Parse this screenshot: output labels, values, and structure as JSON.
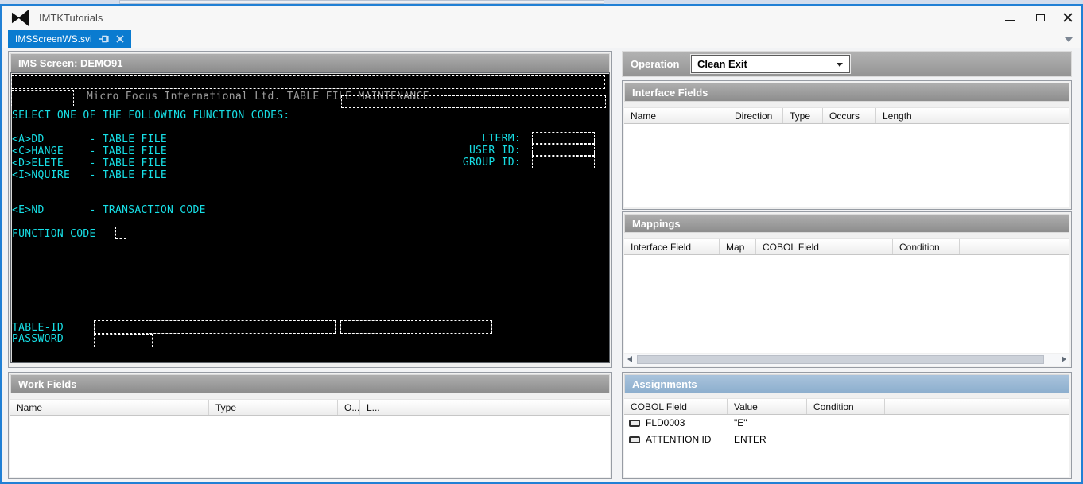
{
  "window": {
    "title": "IMTKTutorials"
  },
  "tabs": [
    {
      "label": "IMSScreenWS.svi",
      "active": true
    }
  ],
  "ims_screen": {
    "header": "IMS Screen: DEMO91",
    "banner": "Micro Focus International Ltd. TABLE FILE MAINTENANCE",
    "select_line": "SELECT ONE OF THE FOLLOWING FUNCTION CODES:",
    "function_codes": [
      "<A>DD       - TABLE FILE",
      "<C>HANGE    - TABLE FILE",
      "<D>ELETE    - TABLE FILE",
      "<I>NQUIRE   - TABLE FILE"
    ],
    "id_labels": "LTERM:\nUSER ID:\nGROUP ID:",
    "end_line": "<E>ND       - TRANSACTION CODE",
    "function_code_label": "FUNCTION CODE",
    "table_id_label": "TABLE-ID",
    "password_label": "PASSWORD",
    "colors": {
      "background": "#000000",
      "text": "#17dfe6",
      "banner_text": "#9e9e9e",
      "field_outline": "#ffffff"
    }
  },
  "work_fields": {
    "header": "Work Fields",
    "columns": [
      "Name",
      "Type",
      "O...",
      "L..."
    ],
    "rows": []
  },
  "operation": {
    "label": "Operation",
    "selected": "Clean Exit"
  },
  "interface_fields": {
    "header": "Interface Fields",
    "columns": [
      "Name",
      "Direction",
      "Type",
      "Occurs",
      "Length"
    ],
    "rows": []
  },
  "mappings": {
    "header": "Mappings",
    "columns": [
      "Interface Field",
      "Map",
      "COBOL Field",
      "Condition"
    ],
    "rows": []
  },
  "assignments": {
    "header": "Assignments",
    "columns": [
      "COBOL Field",
      "Value",
      "Condition"
    ],
    "rows": [
      {
        "cobol_field": "FLD0003",
        "value": "\"E\"",
        "condition": ""
      },
      {
        "cobol_field": "ATTENTION ID",
        "value": "ENTER",
        "condition": ""
      }
    ]
  },
  "colors": {
    "accent_tab": "#0a7bd0",
    "window_border": "#2180d5",
    "panel_header": "#9c9c9c",
    "assignments_header": "#9bb6d2"
  }
}
